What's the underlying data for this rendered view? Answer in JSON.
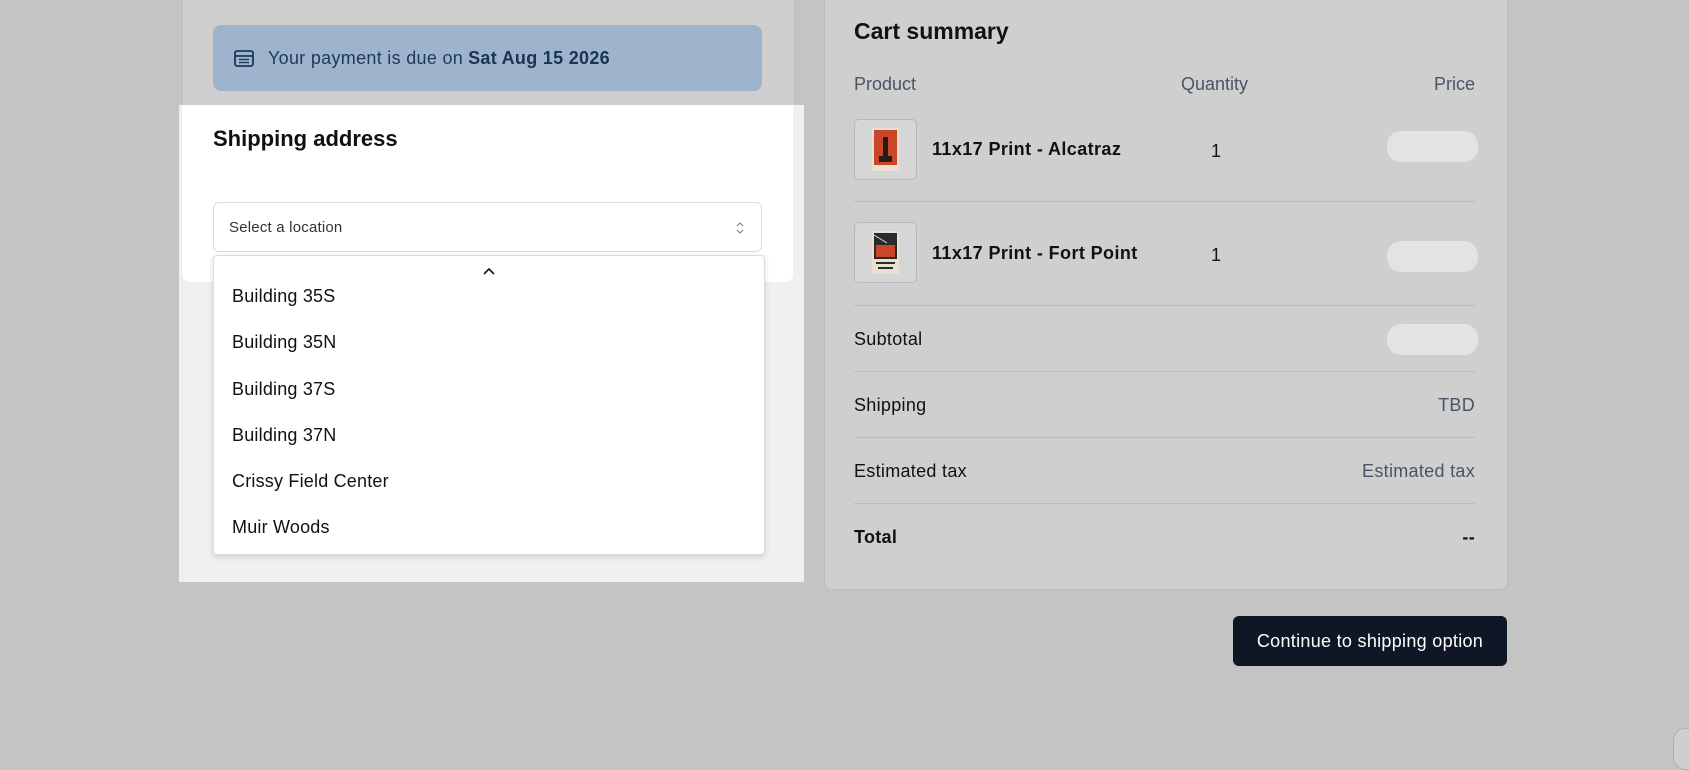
{
  "notice": {
    "text": "Your payment is due on",
    "date": "Sat Aug 15 2026"
  },
  "shipping": {
    "title": "Shipping address",
    "select_placeholder": "Select a location",
    "options": [
      "Building 35S",
      "Building 35N",
      "Building 37S",
      "Building 37N",
      "Crissy Field Center",
      "Muir Woods"
    ]
  },
  "cart": {
    "title": "Cart summary",
    "headers": {
      "product": "Product",
      "quantity": "Quantity",
      "price": "Price"
    },
    "items": [
      {
        "name": "11x17 Print - Alcatraz",
        "quantity": "1",
        "thumb_label": "ALCATRAZ"
      },
      {
        "name": "11x17 Print - Fort Point",
        "quantity": "1",
        "thumb_label": "FORT POINT"
      }
    ],
    "subtotal_label": "Subtotal",
    "shipping_label": "Shipping",
    "shipping_value": "TBD",
    "tax_label": "Estimated tax",
    "tax_value": "Estimated tax",
    "total_label": "Total",
    "total_value": "--"
  },
  "cta_label": "Continue to shipping option",
  "colors": {
    "backdrop": "#c4c4c4",
    "notice_bg": "#9db4cc",
    "cta_bg": "#0f1626"
  }
}
